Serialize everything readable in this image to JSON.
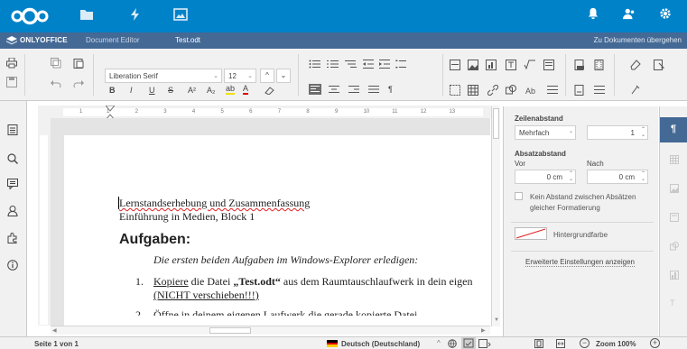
{
  "header": {
    "logo": "nextcloud-logo",
    "icons": [
      "files-icon",
      "activity-icon",
      "gallery-icon",
      "notifications-icon",
      "contacts-icon",
      "settings-icon"
    ]
  },
  "editor_bar": {
    "brand": "ONLYOFFICE",
    "app": "Document Editor",
    "filename": "Test.odt",
    "goto_files": "Zu Dokumenten übergehen"
  },
  "toolbar": {
    "font_family": "Liberation Serif",
    "font_size": "12",
    "bold": "B",
    "italic": "I",
    "underline": "U",
    "strike": "S",
    "superscript": "A²",
    "subscript": "A₂",
    "highlight": "ab",
    "font_color": "A",
    "pilcrow": "¶"
  },
  "ruler": {
    "marks": [
      "1",
      "1",
      "2",
      "3",
      "4",
      "5",
      "6",
      "7",
      "8",
      "9",
      "10",
      "11",
      "12",
      "13"
    ]
  },
  "document": {
    "line1": "Lernstandserhebung und Zusammenfassung",
    "line2": "Einführung in Medien, Block 1",
    "heading": "Aufgaben:",
    "intro": "Die ersten beiden Aufgaben im Windows-Explorer erledigen:",
    "item1_num": "1.",
    "item1_a": "Kopiere",
    "item1_b": " die Datei ",
    "item1_c": "„Test.odt“",
    "item1_d": " aus dem Raumtauschlaufwerk in dein eigen",
    "item1_e": "(NICHT verschieben!!!)",
    "item2_num": "2.",
    "item2_text": "Öffne in deinem eigenen Laufwerk die gerade kopierte Datei."
  },
  "right_panel": {
    "line_spacing_label": "Zeilenabstand",
    "line_spacing_mode": "Mehrfach",
    "line_spacing_value": "1",
    "para_spacing_label": "Absatzabstand",
    "before_label": "Vor",
    "after_label": "Nach",
    "before_value": "0 cm",
    "after_value": "0 cm",
    "no_space_label": "Kein Abstand zwischen Absätzen gleicher Formatierung",
    "no_space_checked": false,
    "bg_color_label": "Hintergrundfarbe",
    "advanced_link": "Erweiterte Einstellungen anzeigen"
  },
  "status": {
    "page": "Seite 1 von 1",
    "language": "Deutsch (Deutschland)",
    "zoom": "Zoom 100%",
    "zoom_out": "−",
    "zoom_in": "+"
  },
  "colors": {
    "nextcloud_blue": "#0082c9",
    "onlyoffice_bar": "#446995",
    "toolbar_bg": "#f1f1f1",
    "active_tab": "#446995"
  }
}
